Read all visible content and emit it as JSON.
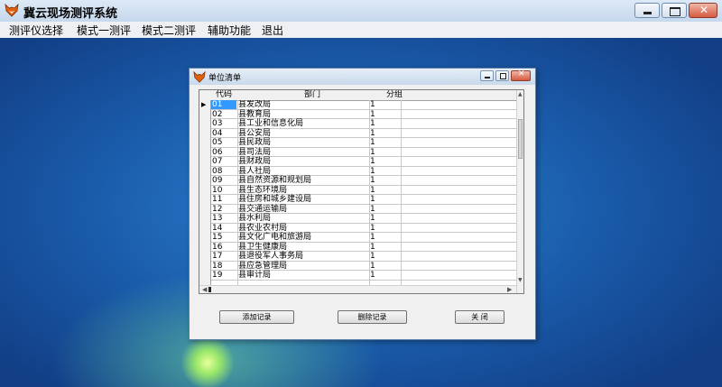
{
  "app": {
    "title": "冀云现场测评系统",
    "menu": [
      "测评仪选择",
      "模式一测评",
      "模式二测评",
      "辅助功能",
      "退出"
    ]
  },
  "dialog": {
    "title": "单位清单",
    "columns": {
      "code": "代码",
      "dept": "部门",
      "group": "分组"
    },
    "selected_row": 0,
    "rows": [
      {
        "code": "01",
        "dept": "县发改局",
        "group": "1"
      },
      {
        "code": "02",
        "dept": "县教育局",
        "group": "1"
      },
      {
        "code": "03",
        "dept": "县工业和信息化局",
        "group": "1"
      },
      {
        "code": "04",
        "dept": "县公安局",
        "group": "1"
      },
      {
        "code": "05",
        "dept": "县民政局",
        "group": "1"
      },
      {
        "code": "06",
        "dept": "县司法局",
        "group": "1"
      },
      {
        "code": "07",
        "dept": "县财政局",
        "group": "1"
      },
      {
        "code": "08",
        "dept": "县人社局",
        "group": "1"
      },
      {
        "code": "09",
        "dept": "县自然资源和规划局",
        "group": "1"
      },
      {
        "code": "10",
        "dept": "县生态环境局",
        "group": "1"
      },
      {
        "code": "11",
        "dept": "县住房和城乡建设局",
        "group": "1"
      },
      {
        "code": "12",
        "dept": "县交通运输局",
        "group": "1"
      },
      {
        "code": "13",
        "dept": "县水利局",
        "group": "1"
      },
      {
        "code": "14",
        "dept": "县农业农村局",
        "group": "1"
      },
      {
        "code": "15",
        "dept": "县文化广电和旅游局",
        "group": "1"
      },
      {
        "code": "16",
        "dept": "县卫生健康局",
        "group": "1"
      },
      {
        "code": "17",
        "dept": "县退役军人事务局",
        "group": "1"
      },
      {
        "code": "18",
        "dept": "县应急管理局",
        "group": "1"
      },
      {
        "code": "19",
        "dept": "县审计局",
        "group": "1"
      }
    ],
    "buttons": {
      "add": "添加记录",
      "delete": "删除记录",
      "close": "关 闭"
    }
  },
  "icons": {
    "app": "fox-logo-icon"
  },
  "colors": {
    "selection": "#3399ff",
    "close_button": "#d55a3f"
  }
}
